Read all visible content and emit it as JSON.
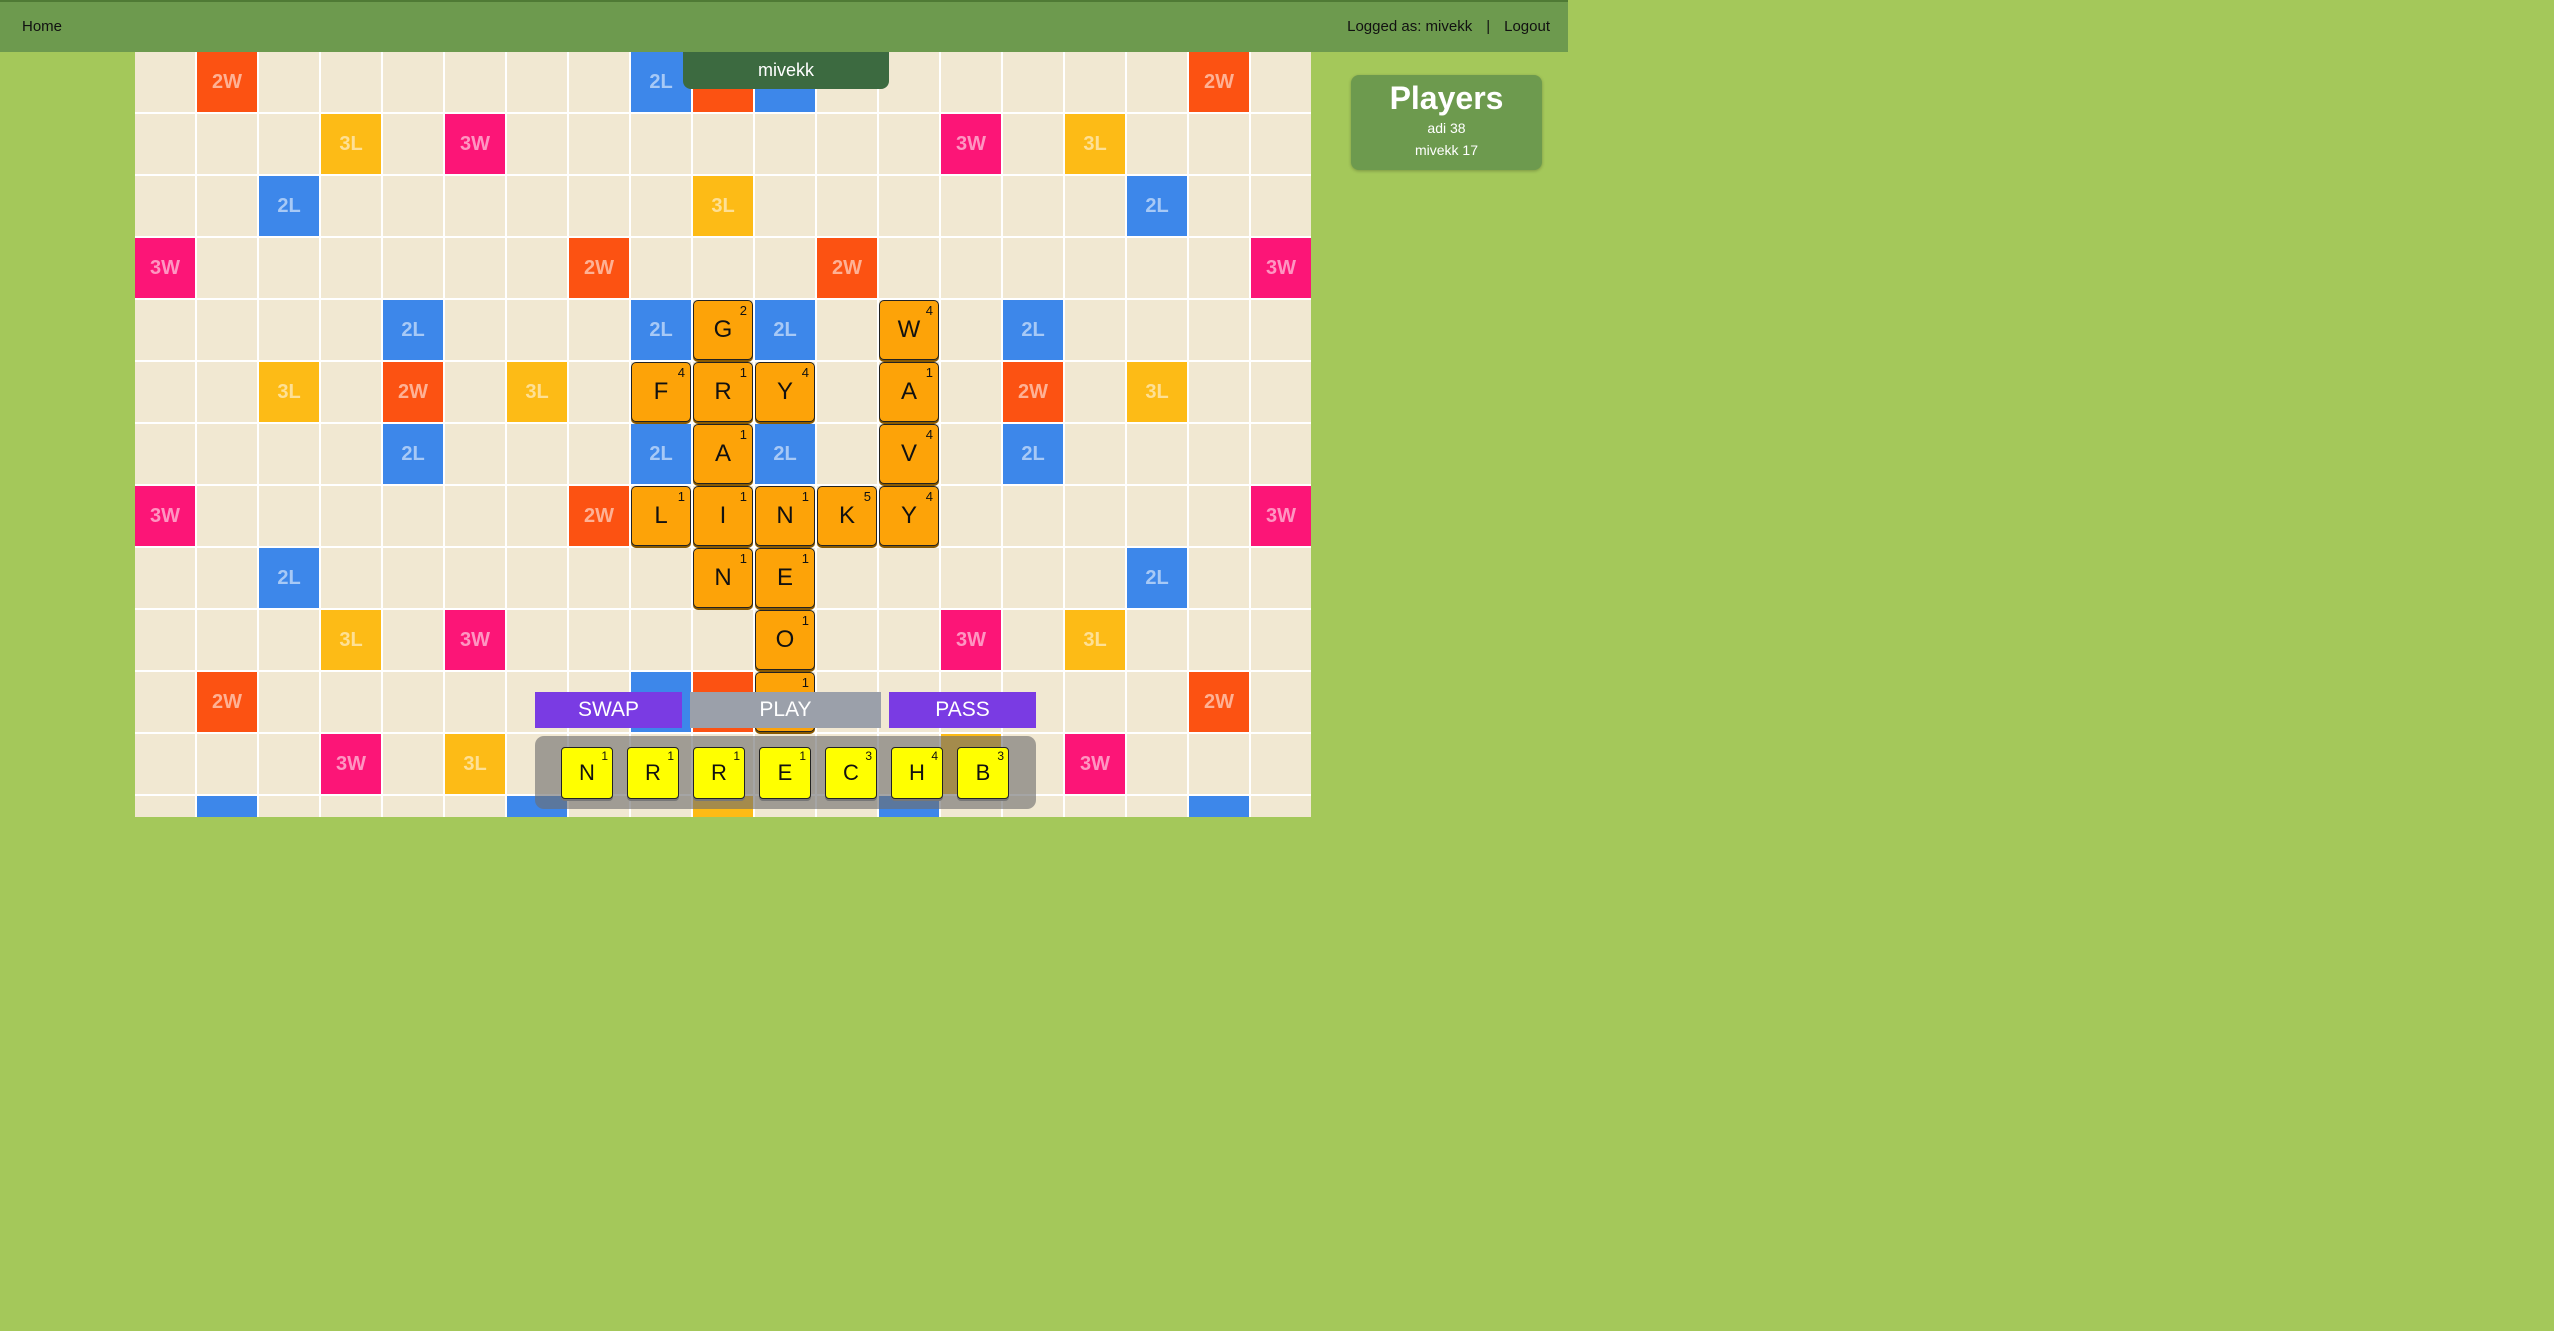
{
  "nav": {
    "home_label": "Home",
    "logged_as": "Logged as: mivekk",
    "separator": "|",
    "logout_label": "Logout"
  },
  "turn_banner": "mivekk",
  "players": {
    "title": "Players",
    "list": [
      {
        "label": "adi 38"
      },
      {
        "label": "mivekk 17"
      }
    ]
  },
  "premium_squares": [
    {
      "row": 0,
      "col": 1,
      "label": "2W",
      "type": "2W"
    },
    {
      "row": 0,
      "col": 8,
      "label": "2L",
      "type": "2L"
    },
    {
      "row": 0,
      "col": 9,
      "label": "2W",
      "type": "2W"
    },
    {
      "row": 0,
      "col": 10,
      "label": "2L",
      "type": "2L"
    },
    {
      "row": 0,
      "col": 17,
      "label": "2W",
      "type": "2W"
    },
    {
      "row": 1,
      "col": 3,
      "label": "3L",
      "type": "3L"
    },
    {
      "row": 1,
      "col": 5,
      "label": "3W",
      "type": "3W"
    },
    {
      "row": 1,
      "col": 13,
      "label": "3W",
      "type": "3W"
    },
    {
      "row": 1,
      "col": 15,
      "label": "3L",
      "type": "3L"
    },
    {
      "row": 2,
      "col": 2,
      "label": "2L",
      "type": "2L"
    },
    {
      "row": 2,
      "col": 9,
      "label": "3L",
      "type": "3L"
    },
    {
      "row": 2,
      "col": 16,
      "label": "2L",
      "type": "2L"
    },
    {
      "row": 3,
      "col": 0,
      "label": "3W",
      "type": "3W"
    },
    {
      "row": 3,
      "col": 7,
      "label": "2W",
      "type": "2W"
    },
    {
      "row": 3,
      "col": 11,
      "label": "2W",
      "type": "2W"
    },
    {
      "row": 3,
      "col": 18,
      "label": "3W",
      "type": "3W"
    },
    {
      "row": 4,
      "col": 4,
      "label": "2L",
      "type": "2L"
    },
    {
      "row": 4,
      "col": 8,
      "label": "2L",
      "type": "2L"
    },
    {
      "row": 4,
      "col": 10,
      "label": "2L",
      "type": "2L"
    },
    {
      "row": 4,
      "col": 14,
      "label": "2L",
      "type": "2L"
    },
    {
      "row": 5,
      "col": 2,
      "label": "3L",
      "type": "3L"
    },
    {
      "row": 5,
      "col": 4,
      "label": "2W",
      "type": "2W"
    },
    {
      "row": 5,
      "col": 6,
      "label": "3L",
      "type": "3L"
    },
    {
      "row": 5,
      "col": 14,
      "label": "2W",
      "type": "2W"
    },
    {
      "row": 5,
      "col": 16,
      "label": "3L",
      "type": "3L"
    },
    {
      "row": 6,
      "col": 4,
      "label": "2L",
      "type": "2L"
    },
    {
      "row": 6,
      "col": 8,
      "label": "2L",
      "type": "2L"
    },
    {
      "row": 6,
      "col": 10,
      "label": "2L",
      "type": "2L"
    },
    {
      "row": 6,
      "col": 14,
      "label": "2L",
      "type": "2L"
    },
    {
      "row": 7,
      "col": 0,
      "label": "3W",
      "type": "3W"
    },
    {
      "row": 7,
      "col": 7,
      "label": "2W",
      "type": "2W"
    },
    {
      "row": 7,
      "col": 18,
      "label": "3W",
      "type": "3W"
    },
    {
      "row": 8,
      "col": 2,
      "label": "2L",
      "type": "2L"
    },
    {
      "row": 8,
      "col": 16,
      "label": "2L",
      "type": "2L"
    },
    {
      "row": 9,
      "col": 3,
      "label": "3L",
      "type": "3L"
    },
    {
      "row": 9,
      "col": 5,
      "label": "3W",
      "type": "3W"
    },
    {
      "row": 9,
      "col": 13,
      "label": "3W",
      "type": "3W"
    },
    {
      "row": 9,
      "col": 15,
      "label": "3L",
      "type": "3L"
    },
    {
      "row": 10,
      "col": 1,
      "label": "2W",
      "type": "2W"
    },
    {
      "row": 10,
      "col": 8,
      "label": "",
      "type": "2L"
    },
    {
      "row": 10,
      "col": 9,
      "label": "",
      "type": "2W"
    },
    {
      "row": 10,
      "col": 17,
      "label": "2W",
      "type": "2W"
    },
    {
      "row": 11,
      "col": 3,
      "label": "3W",
      "type": "3W"
    },
    {
      "row": 11,
      "col": 5,
      "label": "3L",
      "type": "3L"
    },
    {
      "row": 11,
      "col": 13,
      "label": "3L",
      "type": "3L"
    },
    {
      "row": 11,
      "col": 15,
      "label": "3W",
      "type": "3W"
    },
    {
      "row": 12,
      "col": 1,
      "label": "",
      "type": "2L"
    },
    {
      "row": 12,
      "col": 6,
      "label": "",
      "type": "2L"
    },
    {
      "row": 12,
      "col": 9,
      "label": "",
      "type": "3L"
    },
    {
      "row": 12,
      "col": 12,
      "label": "",
      "type": "2L"
    },
    {
      "row": 12,
      "col": 17,
      "label": "",
      "type": "2L"
    }
  ],
  "board_tiles": [
    {
      "row": 4,
      "col": 9,
      "letter": "G",
      "points": "2"
    },
    {
      "row": 4,
      "col": 12,
      "letter": "W",
      "points": "4"
    },
    {
      "row": 5,
      "col": 8,
      "letter": "F",
      "points": "4"
    },
    {
      "row": 5,
      "col": 9,
      "letter": "R",
      "points": "1"
    },
    {
      "row": 5,
      "col": 10,
      "letter": "Y",
      "points": "4"
    },
    {
      "row": 5,
      "col": 12,
      "letter": "A",
      "points": "1"
    },
    {
      "row": 6,
      "col": 9,
      "letter": "A",
      "points": "1"
    },
    {
      "row": 6,
      "col": 12,
      "letter": "V",
      "points": "4"
    },
    {
      "row": 7,
      "col": 8,
      "letter": "L",
      "points": "1"
    },
    {
      "row": 7,
      "col": 9,
      "letter": "I",
      "points": "1"
    },
    {
      "row": 7,
      "col": 10,
      "letter": "N",
      "points": "1"
    },
    {
      "row": 7,
      "col": 11,
      "letter": "K",
      "points": "5"
    },
    {
      "row": 7,
      "col": 12,
      "letter": "Y",
      "points": "4"
    },
    {
      "row": 8,
      "col": 9,
      "letter": "N",
      "points": "1"
    },
    {
      "row": 8,
      "col": 10,
      "letter": "E",
      "points": "1"
    },
    {
      "row": 9,
      "col": 10,
      "letter": "O",
      "points": "1"
    },
    {
      "row": 10,
      "col": 10,
      "letter": "",
      "points": "1"
    }
  ],
  "actions": {
    "swap_label": "SWAP",
    "play_label": "PLAY",
    "pass_label": "PASS"
  },
  "rack": [
    {
      "letter": "N",
      "points": "1"
    },
    {
      "letter": "R",
      "points": "1"
    },
    {
      "letter": "R",
      "points": "1"
    },
    {
      "letter": "E",
      "points": "1"
    },
    {
      "letter": "C",
      "points": "3"
    },
    {
      "letter": "H",
      "points": "4"
    },
    {
      "letter": "B",
      "points": "3"
    }
  ],
  "colors": {
    "2L": "#3d87ea",
    "3L": "#fdbb16",
    "2W": "#fc5212",
    "3W": "#fc1577",
    "tile": "#fda308",
    "rack_tile": "#ffff00"
  }
}
